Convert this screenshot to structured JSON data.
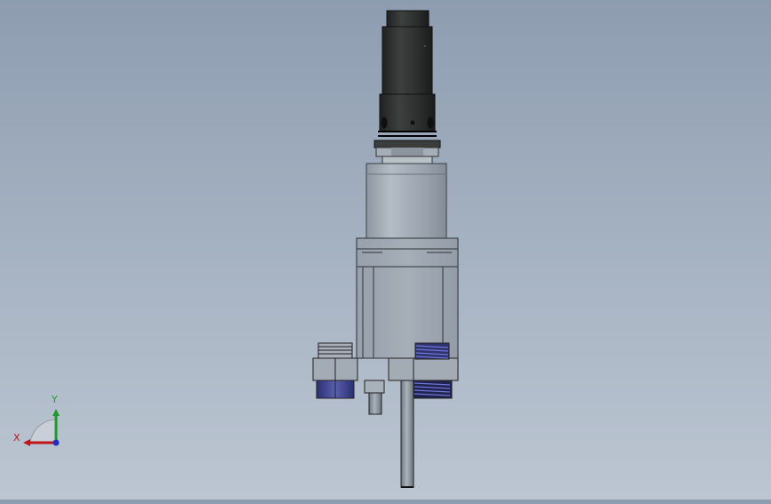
{
  "viewport": {
    "model": "sensor-assembly",
    "background_top": "#8d9db0",
    "background_bottom": "#bcc6d2"
  },
  "triad": {
    "x_label": "X",
    "y_label": "Y",
    "x_color": "#c0151b",
    "y_color": "#1e9a2a",
    "z_color": "#1f2fbf"
  },
  "colors": {
    "dark_body": "#2e312f",
    "steel": "#9aa3ad",
    "nut_blue": "#4b4f9e"
  }
}
